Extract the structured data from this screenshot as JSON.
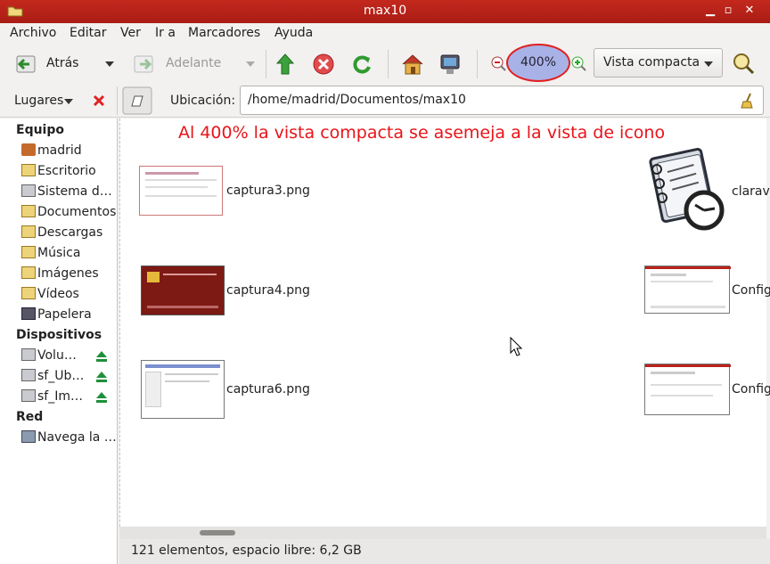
{
  "window": {
    "title": "max10"
  },
  "menu": [
    "Archivo",
    "Editar",
    "Ver",
    "Ir a",
    "Marcadores",
    "Ayuda"
  ],
  "toolbar": {
    "back_label": "Atrás",
    "forward_label": "Adelante",
    "zoom_level": "400%",
    "view_mode": "Vista compacta"
  },
  "location": {
    "places_label": "Lugares",
    "location_label": "Ubicación:",
    "path": "/home/madrid/Documentos/max10"
  },
  "sidebar": {
    "sections": [
      {
        "title": "Equipo",
        "items": [
          "madrid",
          "Escritorio",
          "Sistema d…",
          "Documentos",
          "Descargas",
          "Música",
          "Imágenes",
          "Vídeos",
          "Papelera"
        ]
      },
      {
        "title": "Dispositivos",
        "items": [
          "Volu…",
          "sf_Ub…",
          "sf_Im…"
        ]
      },
      {
        "title": "Red",
        "items": [
          "Navega la …"
        ]
      }
    ]
  },
  "annotation": "Al 400% la vista compacta se asemeja a la vista de icono",
  "files": [
    {
      "name": "captura3.png"
    },
    {
      "name": "captura4.png"
    },
    {
      "name": "captura6.png"
    },
    {
      "name": "clarav"
    },
    {
      "name": "Config"
    },
    {
      "name": "Config"
    }
  ],
  "status": {
    "text": "121 elementos, espacio libre: 6,2 GB"
  },
  "colors": {
    "titlebar": "#b8231a",
    "annotation": "#e8141a",
    "zoom_highlight": "#a9b2e6"
  }
}
